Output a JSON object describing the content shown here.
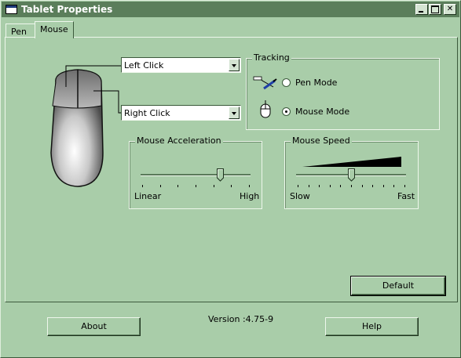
{
  "window": {
    "title": "Tablet Properties"
  },
  "tabs": [
    {
      "label": "Pen"
    },
    {
      "label": "Mouse"
    }
  ],
  "mouse_buttons": {
    "left": {
      "value": "Left Click"
    },
    "right": {
      "value": "Right Click"
    }
  },
  "tracking": {
    "legend": "Tracking",
    "options": [
      {
        "label": "Pen Mode",
        "checked": false
      },
      {
        "label": "Mouse Mode",
        "checked": true
      }
    ]
  },
  "acceleration": {
    "legend": "Mouse Acceleration",
    "min_label": "Linear",
    "max_label": "High",
    "value": 0.72,
    "ticks": 7
  },
  "speed": {
    "legend": "Mouse Speed",
    "min_label": "Slow",
    "max_label": "Fast",
    "value": 0.5,
    "ticks": 11
  },
  "buttons": {
    "default": "Default",
    "about": "About",
    "help": "Help"
  },
  "version": "Version :4.75-9",
  "icons": {
    "pen": "pen-icon",
    "mouse": "mouse-icon"
  }
}
